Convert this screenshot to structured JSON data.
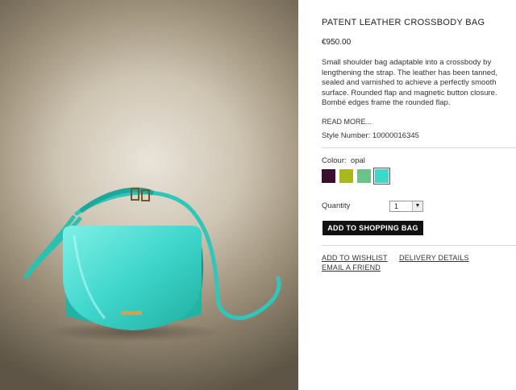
{
  "product": {
    "title": "PATENT LEATHER CROSSBODY BAG",
    "price": "€950.00",
    "description": "Small shoulder bag adaptable into a crossbody by lengthening the strap. The leather has been tanned, sealed and varnished to achieve a perfectly smooth surface. Rounded flap and magnetic button closure. Bombé edges frame the rounded flap.",
    "read_more": "READ MORE...",
    "style_number": "Style Number: 10000016345"
  },
  "colour": {
    "label": "Colour:",
    "selected": "opal",
    "swatches": [
      {
        "name": "plum",
        "color": "#3b0f2e"
      },
      {
        "name": "lime",
        "color": "#a8b81e"
      },
      {
        "name": "green",
        "color": "#6cc38a"
      },
      {
        "name": "opal",
        "color": "#3fd6cc",
        "selected": true
      }
    ]
  },
  "quantity": {
    "label": "Quantity",
    "value": "1"
  },
  "actions": {
    "add_to_bag": "ADD TO SHOPPING BAG",
    "wishlist": "ADD TO WISHLIST",
    "delivery": "DELIVERY DETAILS",
    "email_friend": "EMAIL A FRIEND"
  }
}
